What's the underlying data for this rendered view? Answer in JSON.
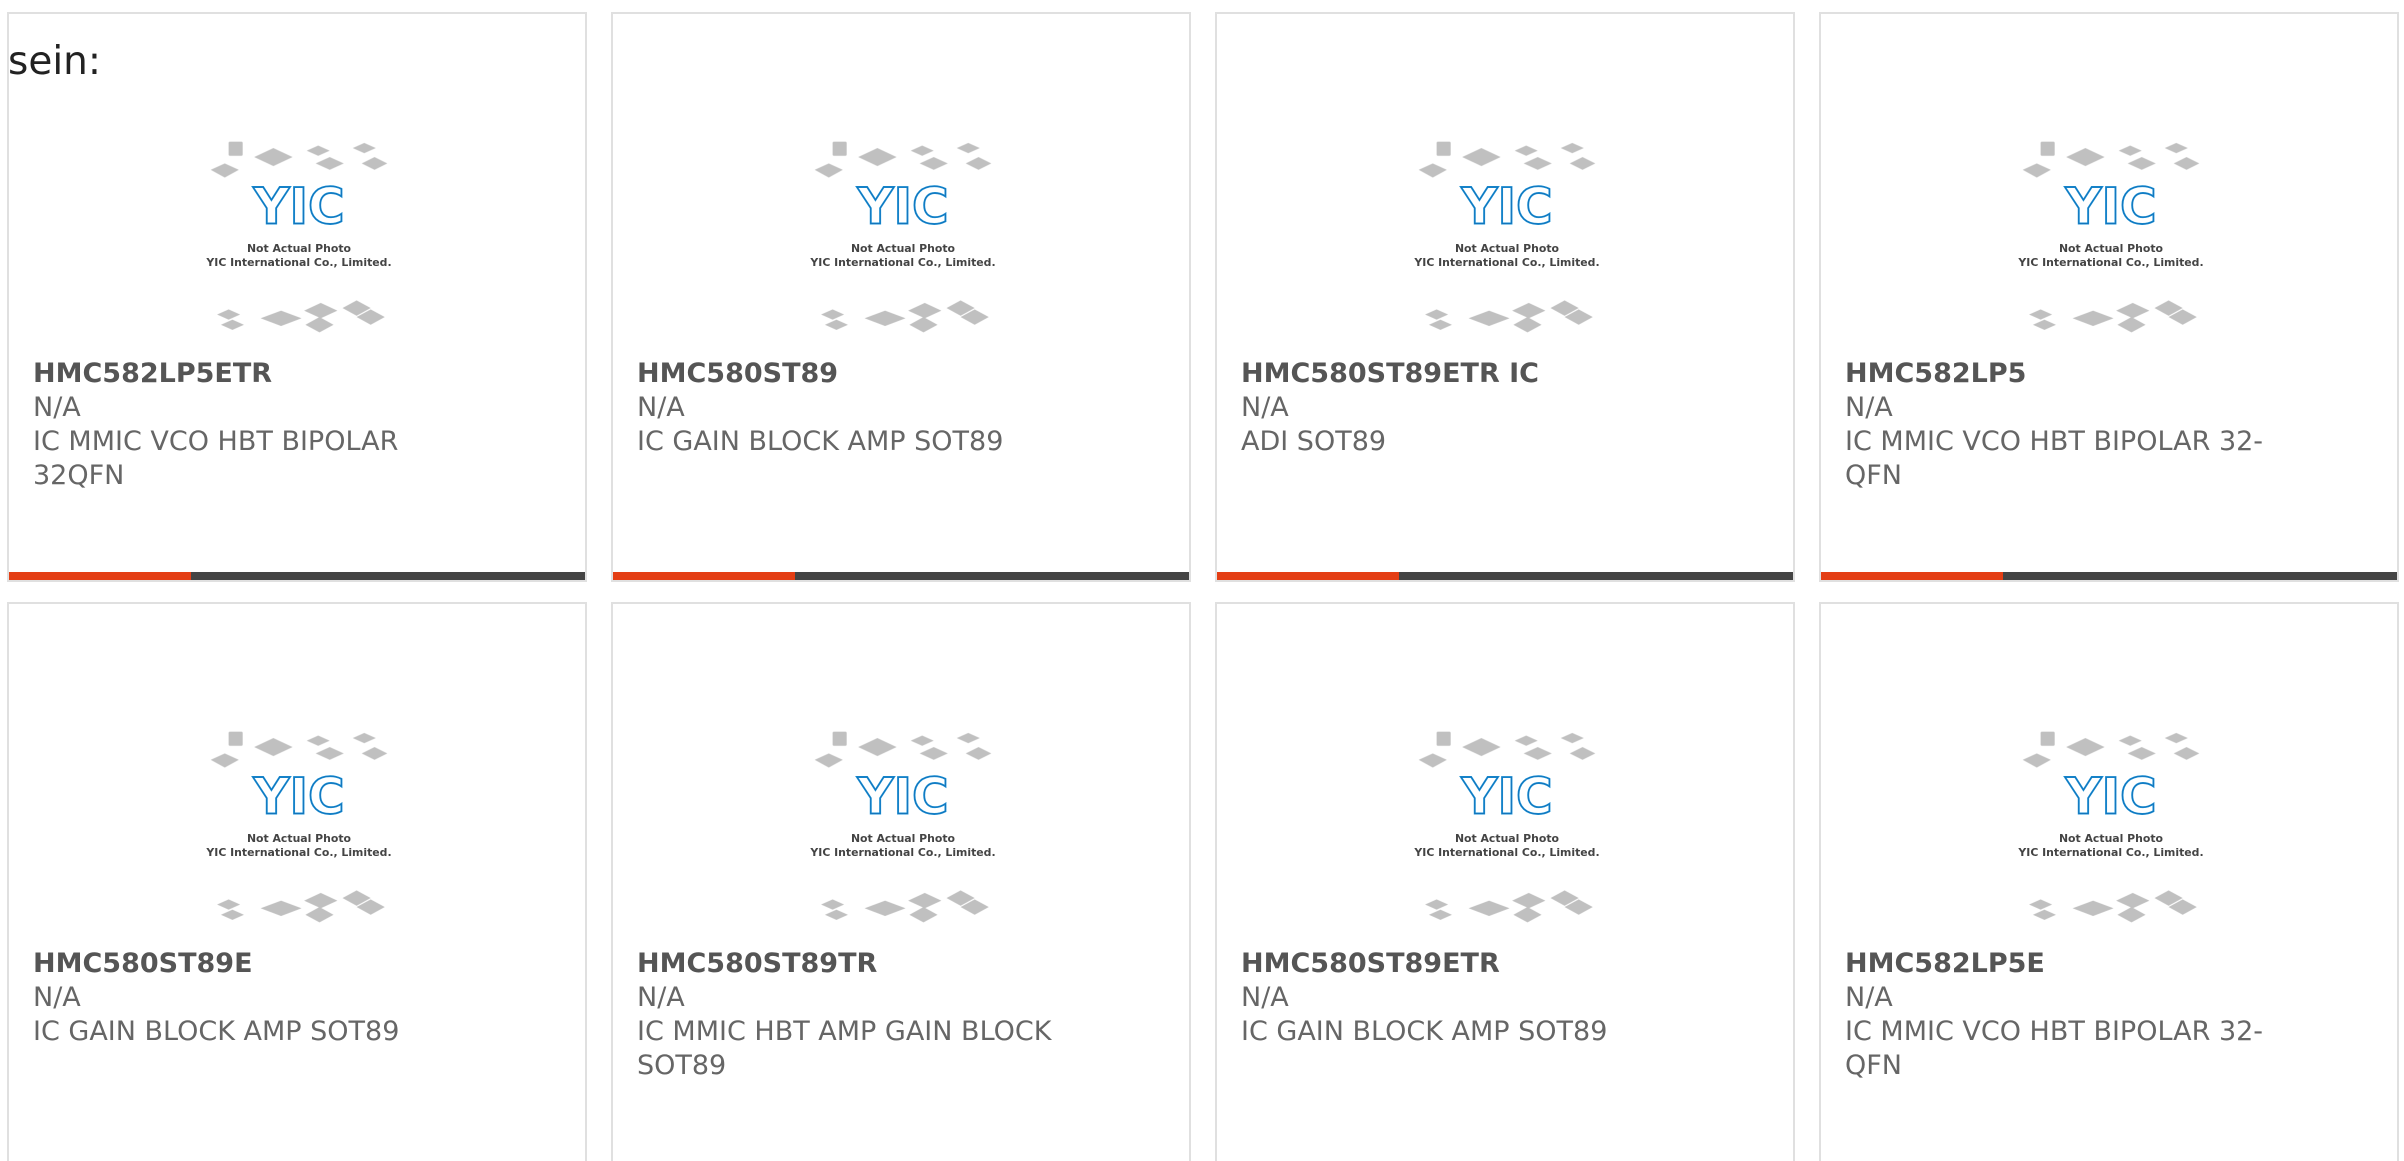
{
  "intro_text": "sein:",
  "colors": {
    "accent_red": "#e43e14",
    "accent_dark": "#444444",
    "logo_blue": "#1a8fd4",
    "logo_dark_blue": "#0d5fa8",
    "chip_gray": "#b5b5b5"
  },
  "placeholder": {
    "line1": "Not Actual Photo",
    "line2": "YIC International Co., Limited.",
    "logo_text": "YIC"
  },
  "products": [
    {
      "part": "HMC582LP5ETR",
      "manufacturer": "N/A",
      "description": "IC MMIC VCO HBT BIPOLAR 32QFN"
    },
    {
      "part": "HMC580ST89",
      "manufacturer": "N/A",
      "description": "IC GAIN BLOCK AMP SOT89"
    },
    {
      "part": "HMC580ST89ETR IC",
      "manufacturer": "N/A",
      "description": "ADI SOT89"
    },
    {
      "part": "HMC582LP5",
      "manufacturer": "N/A",
      "description": "IC MMIC VCO HBT BIPOLAR 32-QFN"
    },
    {
      "part": "HMC580ST89E",
      "manufacturer": "N/A",
      "description": "IC GAIN BLOCK AMP SOT89"
    },
    {
      "part": "HMC580ST89TR",
      "manufacturer": "N/A",
      "description": "IC MMIC HBT AMP GAIN BLOCK SOT89"
    },
    {
      "part": "HMC580ST89ETR",
      "manufacturer": "N/A",
      "description": "IC GAIN BLOCK AMP SOT89"
    },
    {
      "part": "HMC582LP5E",
      "manufacturer": "N/A",
      "description": "IC MMIC VCO HBT BIPOLAR 32-QFN"
    }
  ]
}
